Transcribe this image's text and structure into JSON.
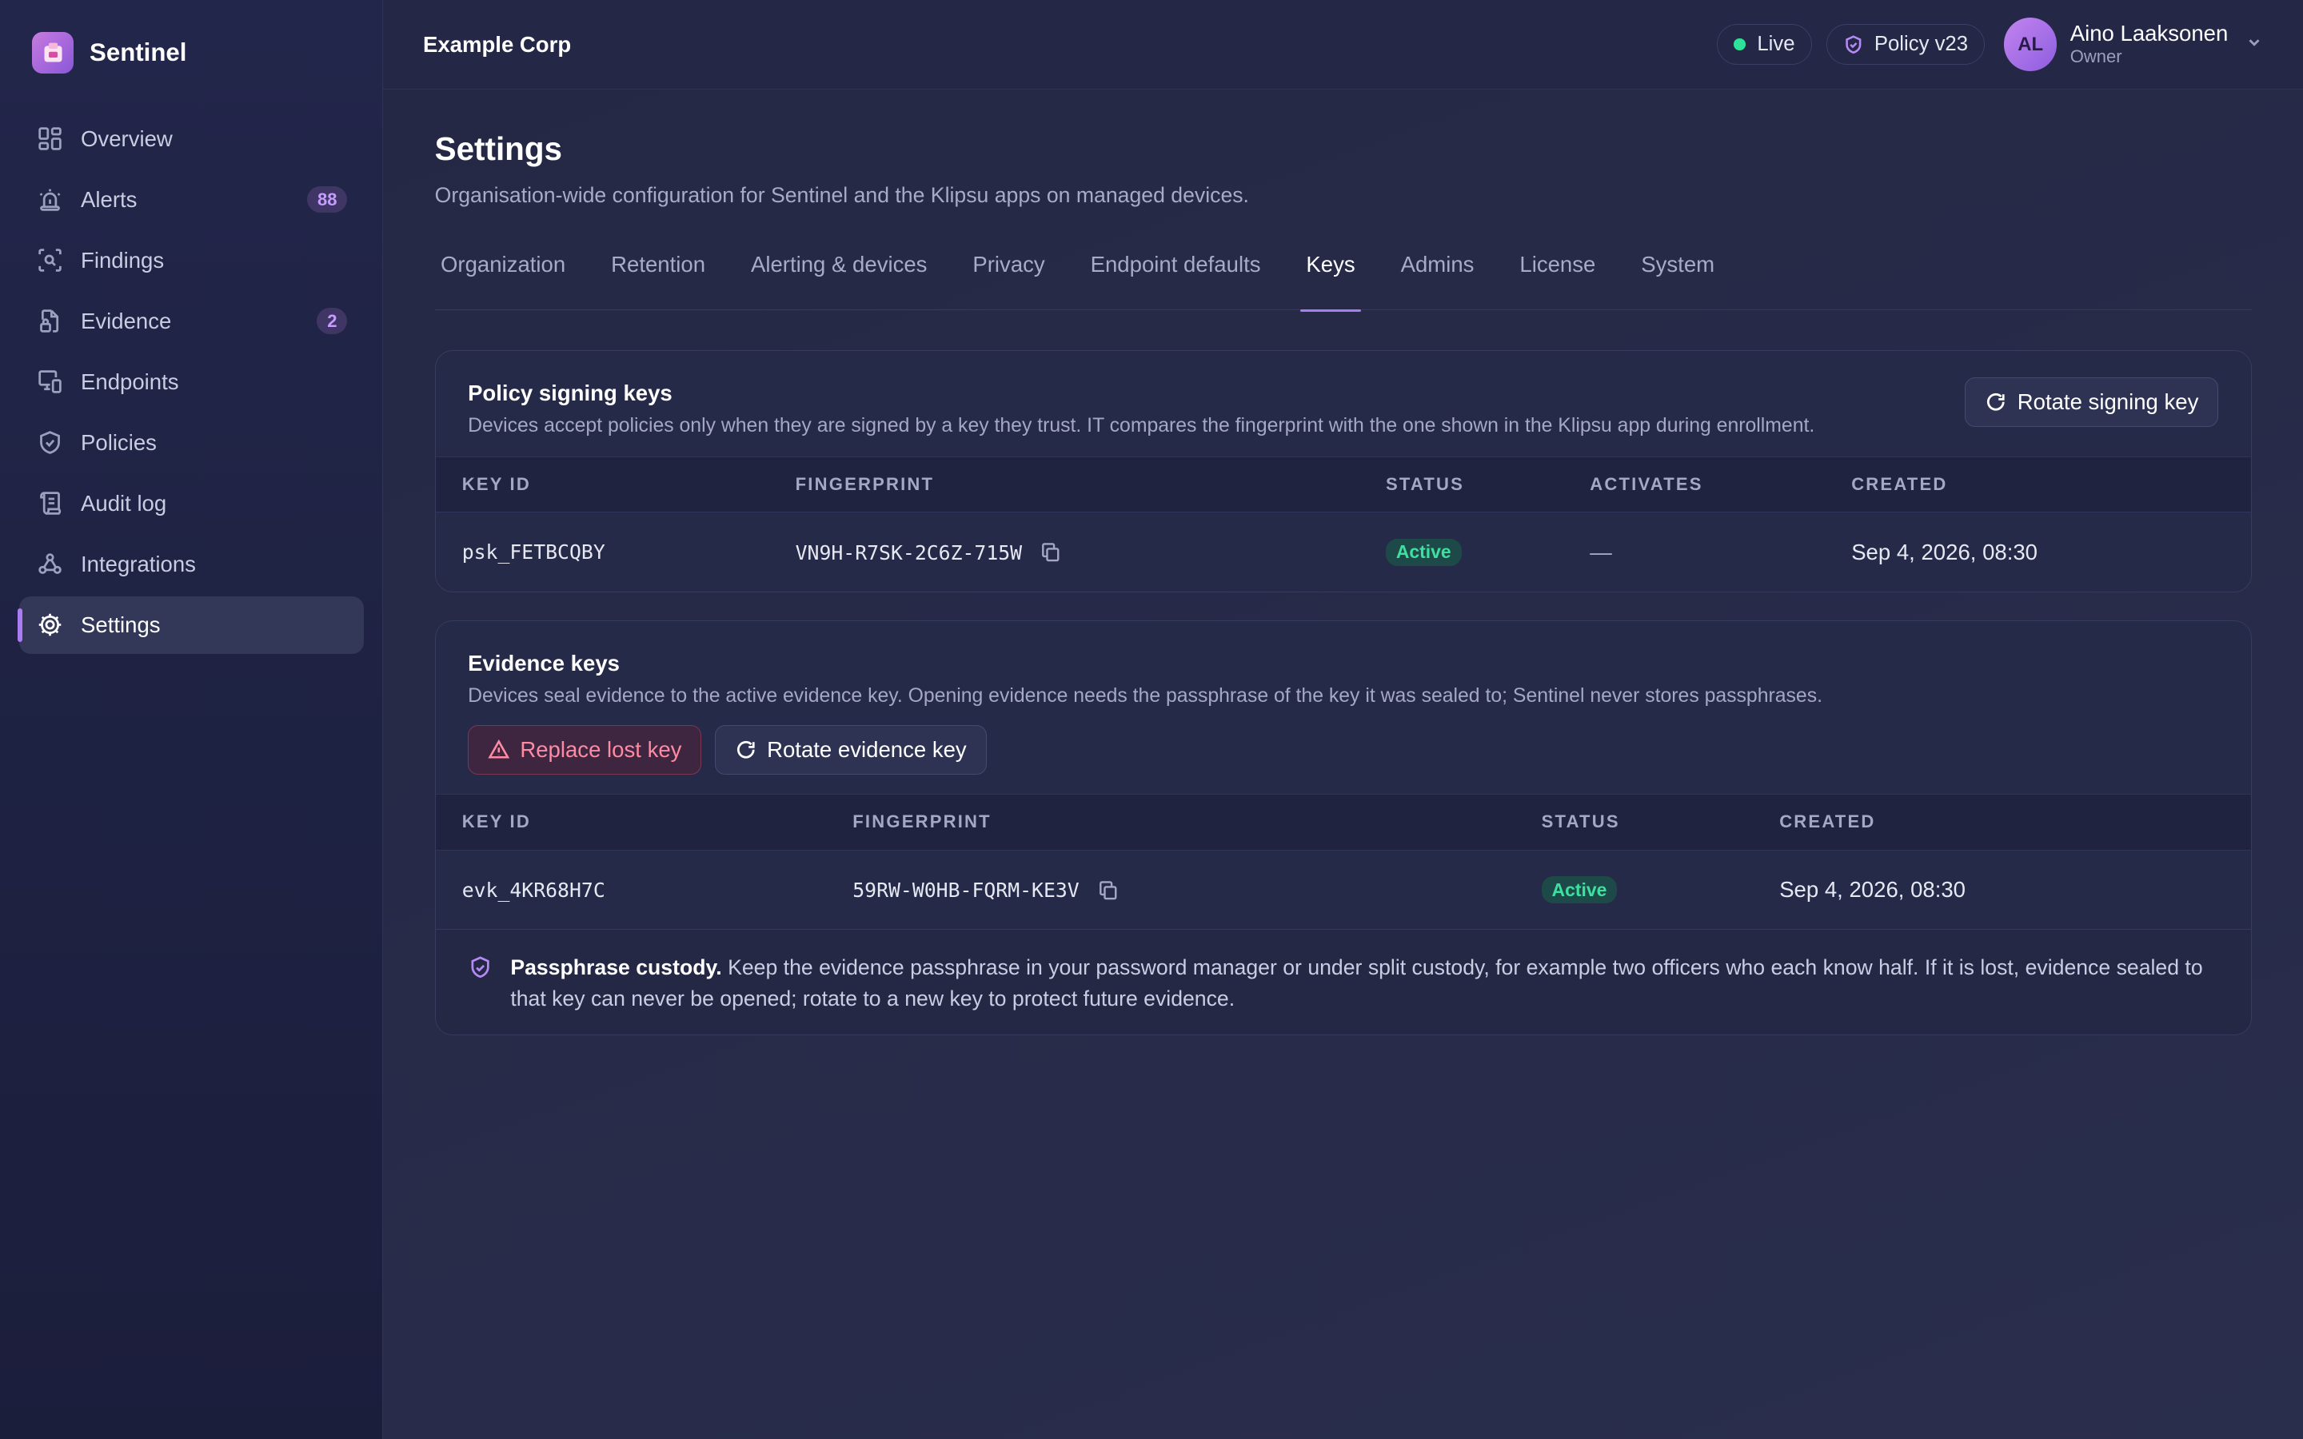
{
  "brand": {
    "name": "Sentinel"
  },
  "sidebar": {
    "items": [
      {
        "label": "Overview",
        "icon": "grid-icon"
      },
      {
        "label": "Alerts",
        "icon": "siren-icon",
        "badge": "88"
      },
      {
        "label": "Findings",
        "icon": "scan-search-icon"
      },
      {
        "label": "Evidence",
        "icon": "file-lock-icon",
        "badge": "2"
      },
      {
        "label": "Endpoints",
        "icon": "devices-icon"
      },
      {
        "label": "Policies",
        "icon": "shield-check-icon"
      },
      {
        "label": "Audit log",
        "icon": "scroll-icon"
      },
      {
        "label": "Integrations",
        "icon": "webhook-icon"
      },
      {
        "label": "Settings",
        "icon": "gear-icon",
        "active": true
      }
    ]
  },
  "topbar": {
    "org": "Example Corp",
    "live_label": "Live",
    "policy_label": "Policy v23",
    "user": {
      "initials": "AL",
      "name": "Aino Laaksonen",
      "role": "Owner"
    }
  },
  "page": {
    "title": "Settings",
    "subtitle": "Organisation-wide configuration for Sentinel and the Klipsu apps on managed devices."
  },
  "tabs": [
    "Organization",
    "Retention",
    "Alerting & devices",
    "Privacy",
    "Endpoint defaults",
    "Keys",
    "Admins",
    "License",
    "System"
  ],
  "active_tab": "Keys",
  "signing": {
    "title": "Policy signing keys",
    "description": "Devices accept policies only when they are signed by a key they trust. IT compares the fingerprint with the one shown in the Klipsu app during enrollment.",
    "rotate_label": "Rotate signing key",
    "columns": [
      "KEY ID",
      "FINGERPRINT",
      "STATUS",
      "ACTIVATES",
      "CREATED"
    ],
    "rows": [
      {
        "key_id": "psk_FETBCQBY",
        "fingerprint": "VN9H-R7SK-2C6Z-715W",
        "status": "Active",
        "activates": "—",
        "created": "Sep 4, 2026, 08:30"
      }
    ]
  },
  "evidence": {
    "title": "Evidence keys",
    "description": "Devices seal evidence to the active evidence key. Opening evidence needs the passphrase of the key it was sealed to; Sentinel never stores passphrases.",
    "replace_label": "Replace lost key",
    "rotate_label": "Rotate evidence key",
    "columns": [
      "KEY ID",
      "FINGERPRINT",
      "STATUS",
      "CREATED"
    ],
    "rows": [
      {
        "key_id": "evk_4KR68H7C",
        "fingerprint": "59RW-W0HB-FQRM-KE3V",
        "status": "Active",
        "created": "Sep 4, 2026, 08:30"
      }
    ],
    "note_title": "Passphrase custody.",
    "note_body": " Keep the evidence passphrase in your password manager or under split custody, for example two officers who each know half. If it is lost, evidence sealed to that key can never be opened; rotate to a new key to protect future evidence."
  },
  "colors": {
    "accent": "#a97cf2",
    "success": "#3ee0a0",
    "danger": "#ff8aa4"
  }
}
